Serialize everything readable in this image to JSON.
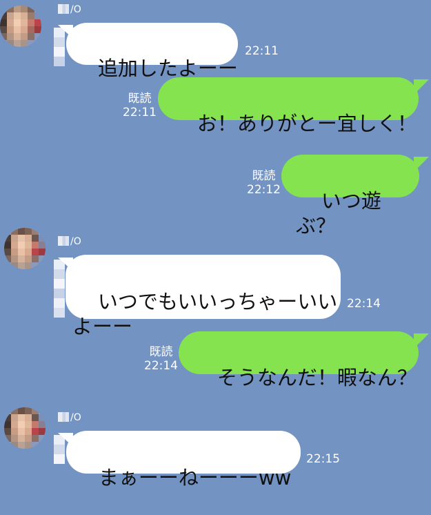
{
  "conversation": {
    "messages": [
      {
        "direction": "in",
        "sender": "/O",
        "text": "追加したよーー",
        "time": "22:11"
      },
      {
        "direction": "out",
        "read_label": "既読",
        "text": "お！ありがとー宜しく！",
        "time": "22:11"
      },
      {
        "direction": "out",
        "read_label": "既読",
        "text": "いつ遊ぶ？",
        "time": "22:12"
      },
      {
        "direction": "in",
        "sender": "/O",
        "text": "いつでもいいっちゃーいい\nよーー",
        "time": "22:14"
      },
      {
        "direction": "out",
        "read_label": "既読",
        "text": "そうなんだ！暇なん？",
        "time": "22:14"
      },
      {
        "direction": "in",
        "sender": "/O",
        "text": "まぁーーねーーーww",
        "time": "22:15"
      }
    ]
  },
  "colors": {
    "background": "#7393c3",
    "incoming_bubble": "#ffffff",
    "outgoing_bubble": "#84e34f",
    "meta_text": "#ffffff"
  }
}
